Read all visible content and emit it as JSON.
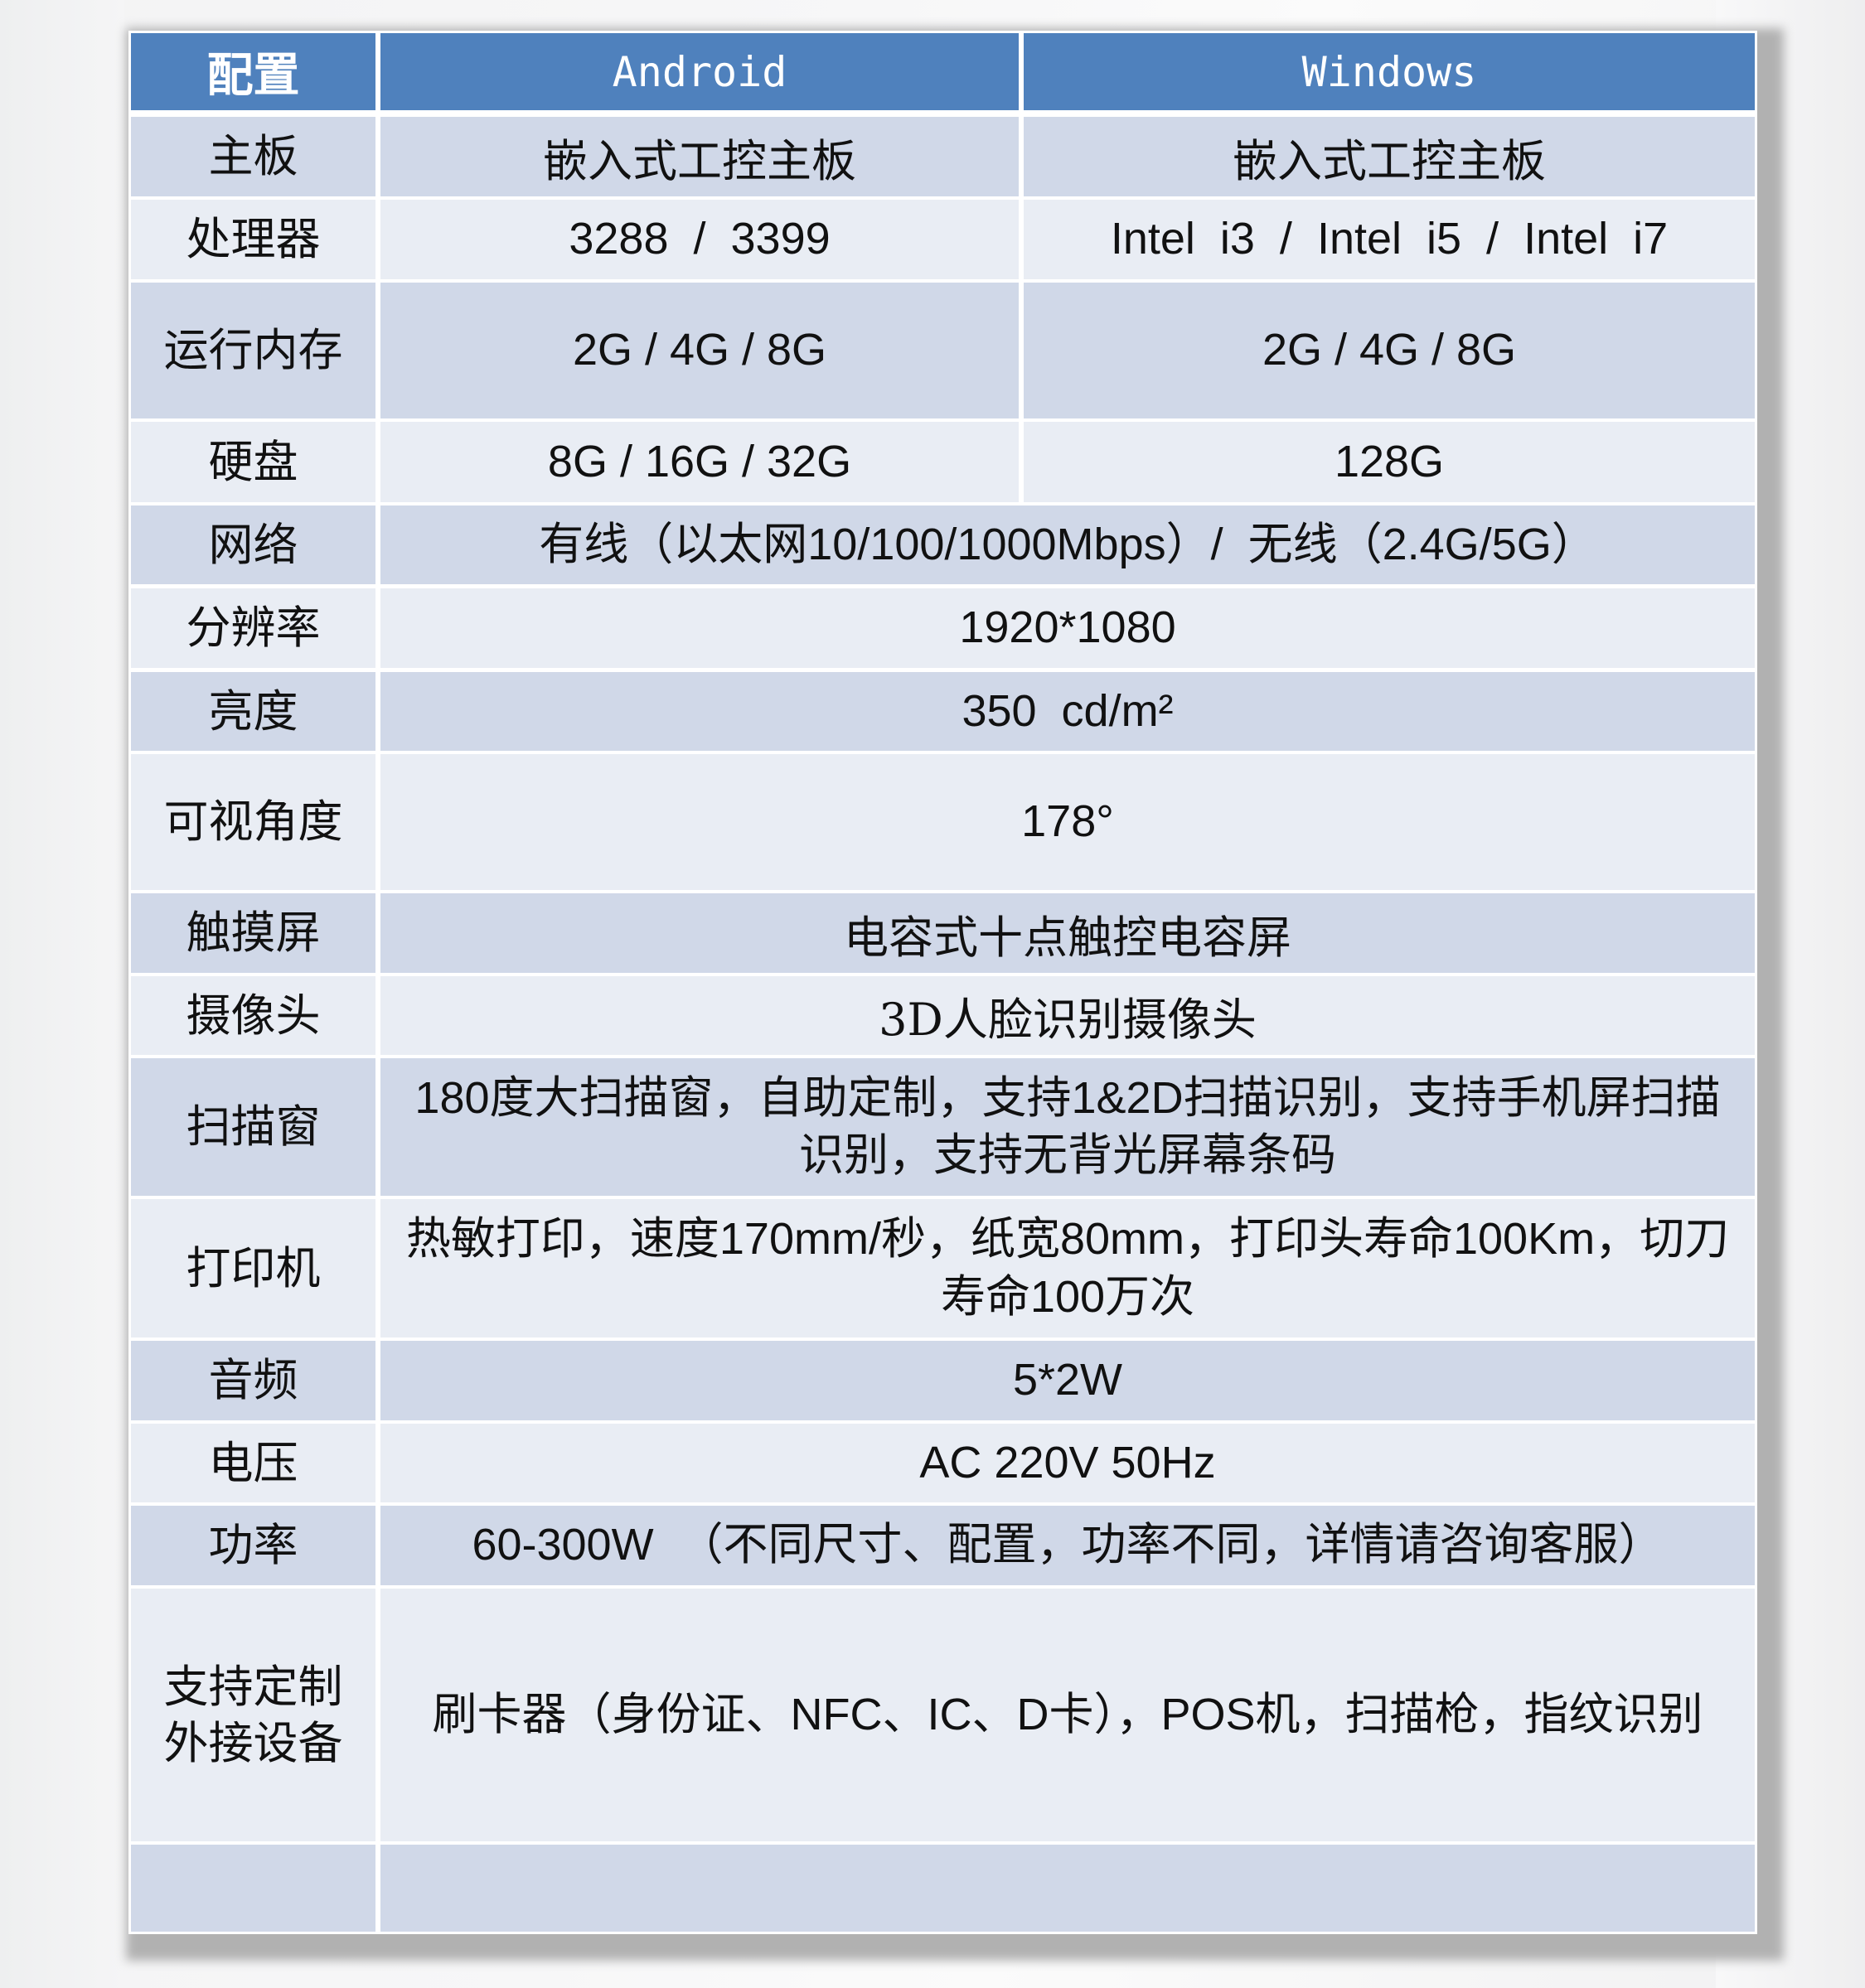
{
  "table": {
    "header": {
      "config": "配置",
      "android": "Android",
      "windows": "Windows"
    },
    "rows": [
      {
        "label": "主板",
        "android": "嵌入式工控主板",
        "windows": "嵌入式工控主板"
      },
      {
        "label": "处理器",
        "android": "3288  /  3399",
        "windows": "Intel  i3  /  Intel  i5  /  Intel  i7"
      },
      {
        "label": "运行内存",
        "android": "2G / 4G / 8G",
        "windows": "2G / 4G / 8G"
      },
      {
        "label": "硬盘",
        "android": "8G / 16G / 32G",
        "windows": "128G"
      },
      {
        "label": "网络",
        "value": "有线（以太网10/100/1000Mbps）/  无线（2.4G/5G）"
      },
      {
        "label": "分辨率",
        "value": "1920*1080"
      },
      {
        "label": "亮度",
        "value": "350  cd/m²"
      },
      {
        "label": "可视角度",
        "value": "178°"
      },
      {
        "label": "触摸屏",
        "value": "电容式十点触控电容屏"
      },
      {
        "label": "摄像头",
        "value": "3D人脸识别摄像头"
      },
      {
        "label": "扫描窗",
        "value": "180度大扫描窗，自助定制，支持1&2D扫描识别，支持手机屏扫描识别，支持无背光屏幕条码"
      },
      {
        "label": "打印机",
        "value": "热敏打印，速度170mm/秒，纸宽80mm，打印头寿命100Km，切刀寿命100万次"
      },
      {
        "label": "音频",
        "value": "5*2W"
      },
      {
        "label": "电压",
        "value": "AC 220V 50Hz"
      },
      {
        "label": "功率",
        "value": "60-300W  （不同尺寸、配置，功率不同，详情请咨询客服）"
      },
      {
        "label": "支持定制外接设备",
        "value": "刷卡器（身份证、NFC、IC、D卡），POS机，扫描枪，指纹识别"
      },
      {
        "label": "",
        "value": ""
      }
    ]
  },
  "colors": {
    "header_bg": "#4f81bd",
    "row_dark": "#d0d8e8",
    "row_light": "#e9edf4"
  }
}
